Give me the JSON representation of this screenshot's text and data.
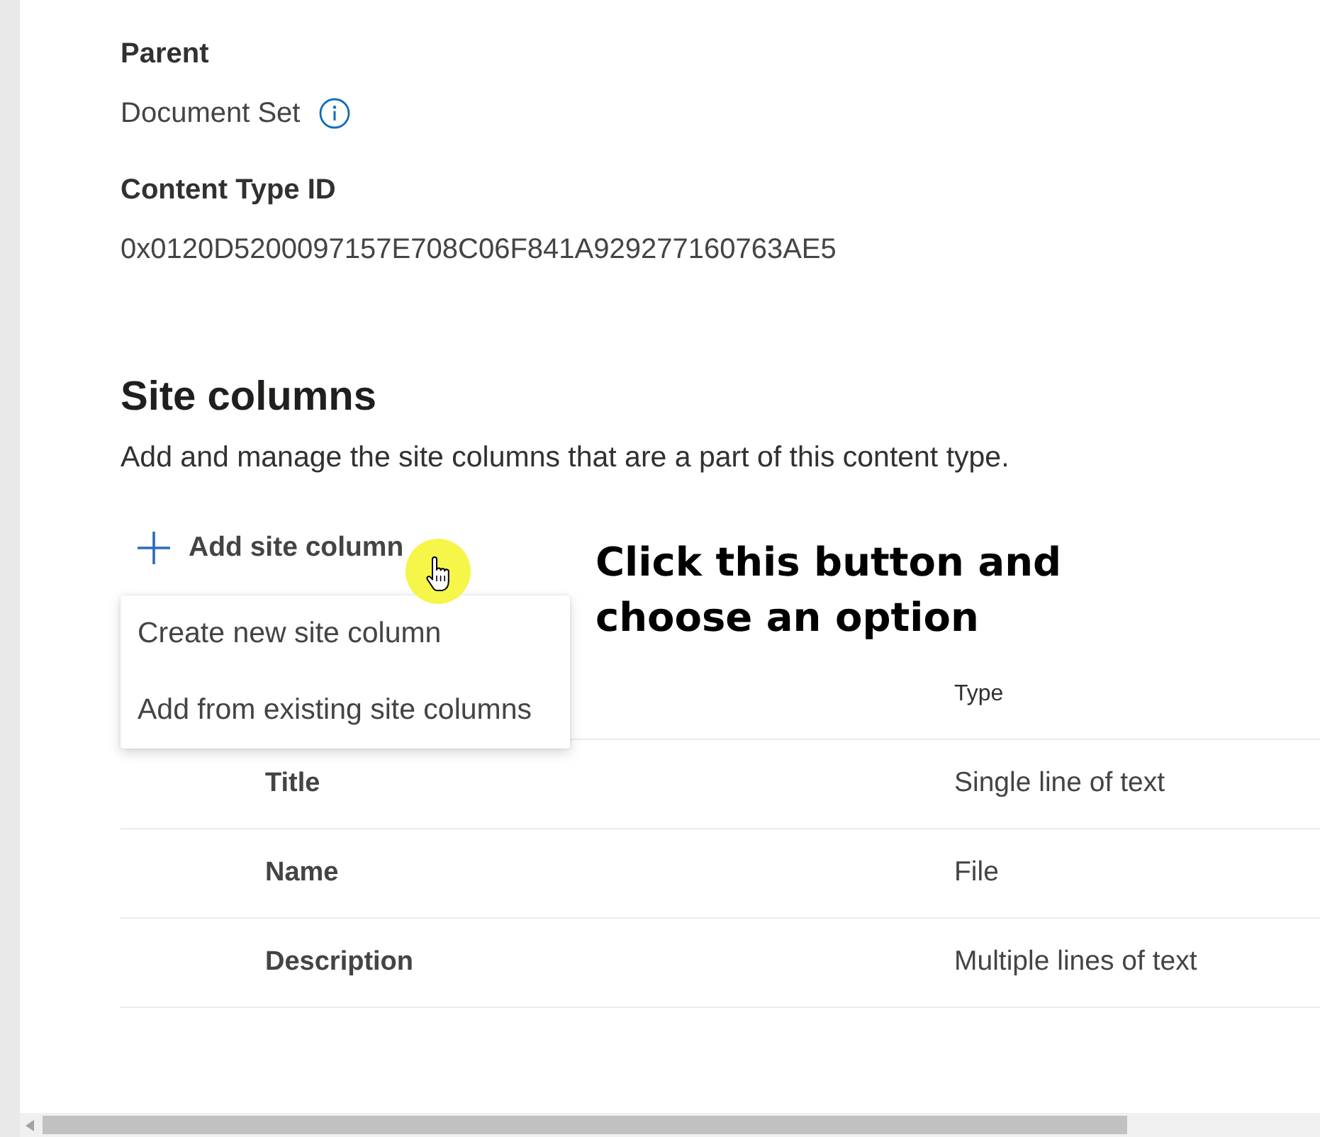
{
  "properties": [
    {
      "label": "Parent",
      "value": "Document Set",
      "info": true
    },
    {
      "label": "Content Type ID",
      "value": "0x0120D5200097157E708C06F841A929277160763AE5",
      "info": false
    }
  ],
  "site_columns": {
    "title": "Site columns",
    "description": "Add and manage the site columns that are a part of this content type."
  },
  "add_button": {
    "label": "Add site column",
    "expanded": true,
    "menu": [
      {
        "label": "Create new site column"
      },
      {
        "label": "Add from existing site columns"
      }
    ]
  },
  "annotation": {
    "text": "Click this button and choose an option"
  },
  "table": {
    "type_header": "Type",
    "rows": [
      {
        "column_1": "Title",
        "type": "Single line of text"
      },
      {
        "column_1": "Name",
        "type": "File"
      },
      {
        "column_1": "Description",
        "type": "Multiple lines of text"
      }
    ]
  }
}
